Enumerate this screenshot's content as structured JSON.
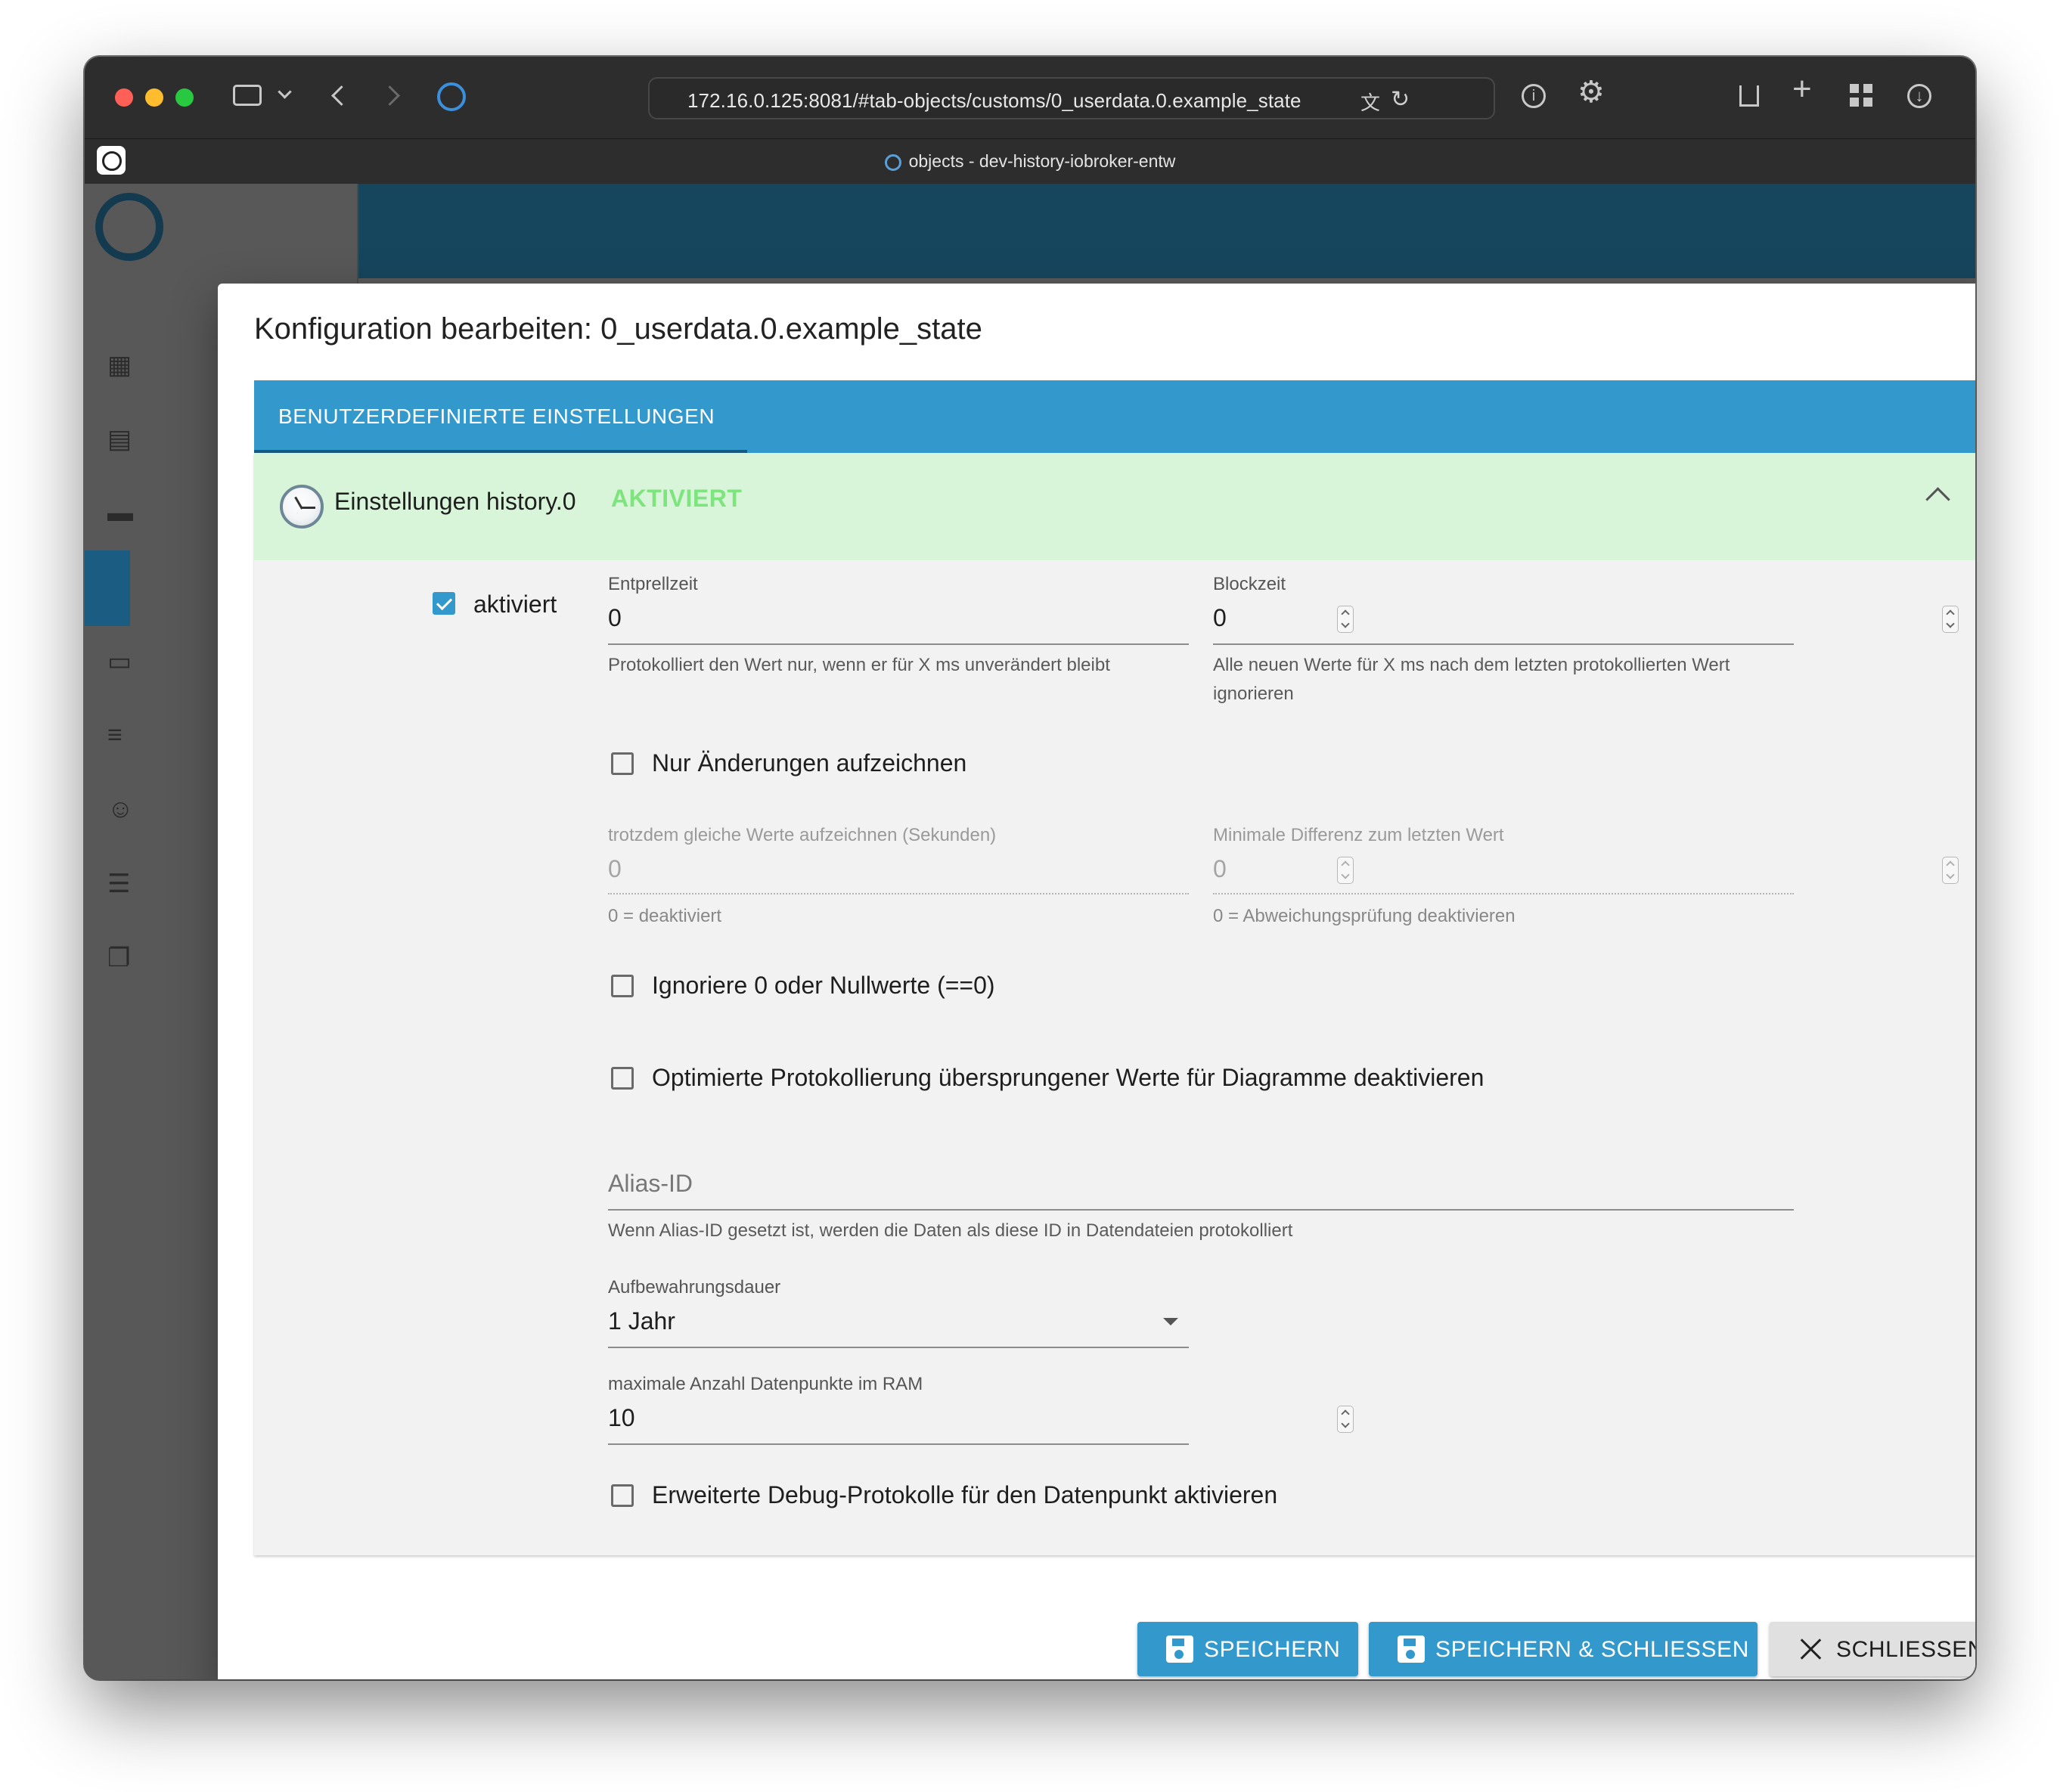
{
  "browser": {
    "url": "172.16.0.125:8081/#tab-objects/customs/0_userdata.0.example_state",
    "tab_title": "objects - dev-history-iobroker-entw"
  },
  "dialog": {
    "title": "Konfiguration bearbeiten: 0_userdata.0.example_state",
    "tab_label": "BENUTZERDEFINIERTE EINSTELLUNGEN",
    "accordion": {
      "title": "Einstellungen history.0",
      "status": "AKTIVIERT",
      "status_color": "#7ee47e"
    },
    "enabled": {
      "label": "aktiviert",
      "checked": true
    },
    "debounce": {
      "label": "Entprellzeit",
      "value": "0",
      "help": "Protokolliert den Wert nur, wenn er für X ms unverändert bleibt"
    },
    "blocktime": {
      "label": "Blockzeit",
      "value": "0",
      "help_line1": "Alle neuen Werte für X ms nach dem letzten protokollierten Wert",
      "help_line2": "ignorieren"
    },
    "changes_only": {
      "label": "Nur Änderungen aufzeichnen",
      "checked": false
    },
    "changes_relog": {
      "label": "trotzdem gleiche Werte aufzeichnen (Sekunden)",
      "value": "0",
      "help": "0 = deaktiviert"
    },
    "changes_min_delta": {
      "label": "Minimale Differenz zum letzten Wert",
      "value": "0",
      "help": "0 = Abweichungsprüfung deaktivieren"
    },
    "ignore_zero": {
      "label": "Ignoriere 0 oder Nullwerte (==0)",
      "checked": false
    },
    "disable_skipped": {
      "label": "Optimierte Protokollierung übersprungener Werte für Diagramme deaktivieren",
      "checked": false
    },
    "alias": {
      "placeholder": "Alias-ID",
      "help": "Wenn Alias-ID gesetzt ist, werden die Daten als diese ID in Datendateien protokolliert"
    },
    "retention": {
      "label": "Aufbewahrungsdauer",
      "value": "1 Jahr"
    },
    "max_length": {
      "label": "maximale Anzahl Datenpunkte im RAM",
      "value": "10"
    },
    "debug": {
      "label": "Erweiterte Debug-Protokolle für den Datenpunkt aktivieren",
      "checked": false
    },
    "buttons": {
      "save": "SPEICHERN",
      "save_close": "SPEICHERN & SCHLIESSEN",
      "close": "SCHLIESSEN"
    },
    "accent_color": "#3399cc"
  }
}
